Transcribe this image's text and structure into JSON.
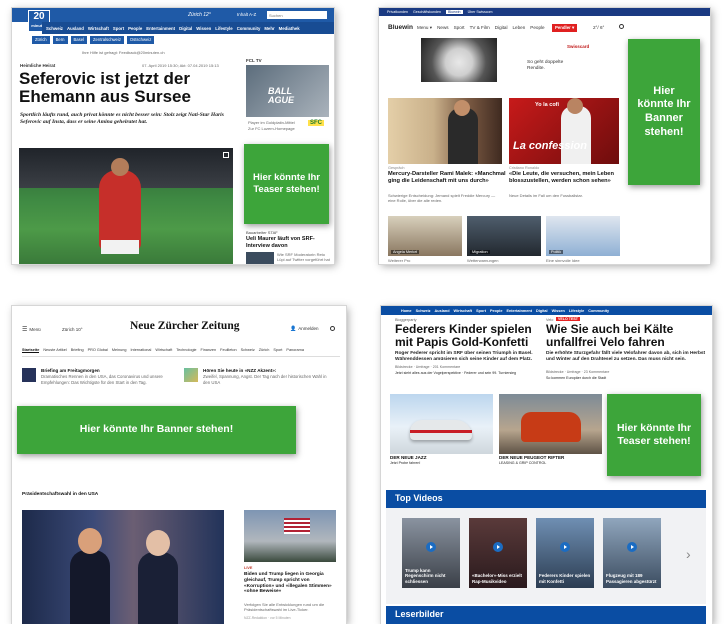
{
  "s1": {
    "logo_line1": "20",
    "logo_line2": "minuten",
    "weather": "Zürich 12°",
    "search_label": "Inhalt A-Z",
    "search_placeholder": "Suchen",
    "nav": [
      "Schweiz",
      "Ausland",
      "Wirtschaft",
      "Sport",
      "People",
      "Entertainment",
      "Digital",
      "Wissen",
      "Lifestyle",
      "Community",
      "Mehr",
      "Mediathek"
    ],
    "subnav": [
      "Zürich",
      "Bern",
      "Basel",
      "Zentralschweiz",
      "Ostschweiz"
    ],
    "feedback": "Ihre Hilfe ist gefragt: Feedback@20minuten.ch",
    "kicker": "Heimliche Heirat",
    "date": "07. April 2019 15:30; Akt: 07.04.2019 15:13",
    "headline": "Seferovic ist jetzt der Ehemann aus Sursee",
    "lead": "Sportlich läufts rund, auch privat könnte es nicht besser sein: Stolz zeigt Nati-Star Haris Seferovic auf Insta, dass er seine Amina geheiratet hat.",
    "side_label": "FCL TV",
    "side_banner": "BALL AGUE",
    "side_link1": "Player im Goldplatin-Mittel",
    "side_link2": "Zur FC Luzern-Homepage",
    "sfc": "SFC",
    "teaser": "Hier könnte Ihr Teaser stehen!",
    "side_kicker": "Bauarbeiter STAF",
    "side_head": "Ueli Maurer läuft von SRF-Interview davon",
    "side_text": "Wie SRF Moderatorin Reto Lüpi auf Twitter vorgeführt hat"
  },
  "s2": {
    "tabs": [
      "Privatkunden",
      "Geschäftskunden",
      "Bluewin",
      "Über Swisscom"
    ],
    "logo": "Bluewin",
    "menu": [
      "Menu ▾",
      "News",
      "Sport",
      "TV & Film",
      "Digital",
      "Leben",
      "People"
    ],
    "pendeln": "Pendler ▾",
    "weather": "2°/ 6°",
    "ad_brand": "Swisscard",
    "ad_text": "So geht doppelte Rendite.",
    "banner": "Hier könnte Ihr Banner stehen!",
    "story1_kicker": "Gespräch",
    "story1_head": "Mercury-Darsteller Rami Malek: «Manchmal ging die Leidenschaft mit uns durch»",
    "story1_text": "Schwierige Entscheidung: Jemand spielt Freddie Mercury — eine Rolle, über die alle reden.",
    "story2_kicker": "Cristiano Ronaldo",
    "story2_head": "«Die Leute, die versuchen, mein Leben blosszustellen, werden schon sehen»",
    "story2_text": "Neue Details im Fall um den Fussballstar.",
    "confession": "La confession",
    "confession_top": "Yo la cofi",
    "thumb1": "Angela Merkel",
    "thumb2": "Migration",
    "thumb3": "Politik",
    "bottom1": "Weiterer Pro",
    "bottom2": "Wetterwarnungen",
    "bottom3": "Eine sinnvolle Idee"
  },
  "s3": {
    "menu": "Menü",
    "weather": "Zürich 10°",
    "logo": "Neue Zürcher Zeitung",
    "login": "Anmelden",
    "nav": [
      "Startseite",
      "Neuste Artikel",
      "Briefing",
      "PRO Global",
      "Meinung",
      "International",
      "Wirtschaft",
      "Technologie",
      "Finanzen",
      "Feuilleton",
      "Schweiz",
      "Zürich",
      "Sport",
      "Panorama"
    ],
    "briefing_head": "Briefing am Freitagmorgen",
    "briefing_text": "Dramatisches Rennen in den USA, das Coronavirus und unsere Empfehlungen: Das Wichtigste für den Start in den Tag.",
    "podcast_head": "Hören Sie heute in «NZZ Akzent»:",
    "podcast_text": "Zweifel, Spannung, Angst. Der Tag nach der historischen Wahl in den USA",
    "banner": "Hier könnte Ihr Banner stehen!",
    "section": "Präsidentschaftswahl in den USA",
    "live": "LIVE",
    "side_head": "Biden und Trump liegen in Georgia gleichauf, Trump spricht von «Korruption» und «illegalen Stimmen» «ohne Beweise»",
    "side_text": "Verfolgen Sie alle Entwicklungen rund um die Präsidentschaftswahl im Live-Ticker.",
    "side_meta": "NZZ-Redaktion · vor 5 Minuten"
  },
  "s4": {
    "nav": [
      "Home",
      "Schweiz",
      "Ausland",
      "Wirtschaft",
      "Sport",
      "People",
      "Entertainment",
      "Digital",
      "Wissen",
      "Lifestyle",
      "Community"
    ],
    "left_kicker": "Bloggerparty",
    "left_head": "Federers Kinder spielen mit Papis Gold-Konfetti",
    "left_text": "Roger Federer spricht im SRF über seinen Triumph in Basel. Währenddessen amüsieren sich seine Kinder auf dem Platz.",
    "left_meta1": "Bildstrecke · Umfrage · 201 Kommentare",
    "left_meta2": "Jetzt sieht alles aus der Vogelperspektive · Federer und sein 99. Turniersieg",
    "right_kicker": "Velo",
    "right_badge": "VELO TEST",
    "right_head": "Wie Sie auch bei Kälte unfallfrei Velo fahren",
    "right_text": "Die erhöhte Sturzgefahr fällt viele Velofahrer davon ab, sich im Herbst und Winter auf den Drahtesel zu setzen. Das muss nicht sein.",
    "right_meta1": "Bildstrecke · Umfrage · 23 Kommentare",
    "right_meta2": "So kommen Europäer durch die Stadt",
    "car1_head": "DER NEUE JAZZ",
    "car1_text": "Jetzt Probe fahren!",
    "car2_head": "DER NEUE PEUGEOT RIFTER",
    "car2_text": "LEASING & GRIP CONTROL",
    "teaser": "Hier könnte Ihr Teaser stehen!",
    "videos_title": "Top Videos",
    "videos": [
      {
        "title": "Trump kann Regenschirm nicht schliessen"
      },
      {
        "title": "«Bachelor»-Miss erzielt Rap-Musikvideo"
      },
      {
        "title": "Federers Kinder spielen mit Konfetti"
      },
      {
        "title": "Flugzeug mit 189 Passagieren abgestürzt"
      }
    ],
    "reader_title": "Leserbilder",
    "colors": {
      "blue": "#0a4da3",
      "green": "#3da53a"
    }
  }
}
